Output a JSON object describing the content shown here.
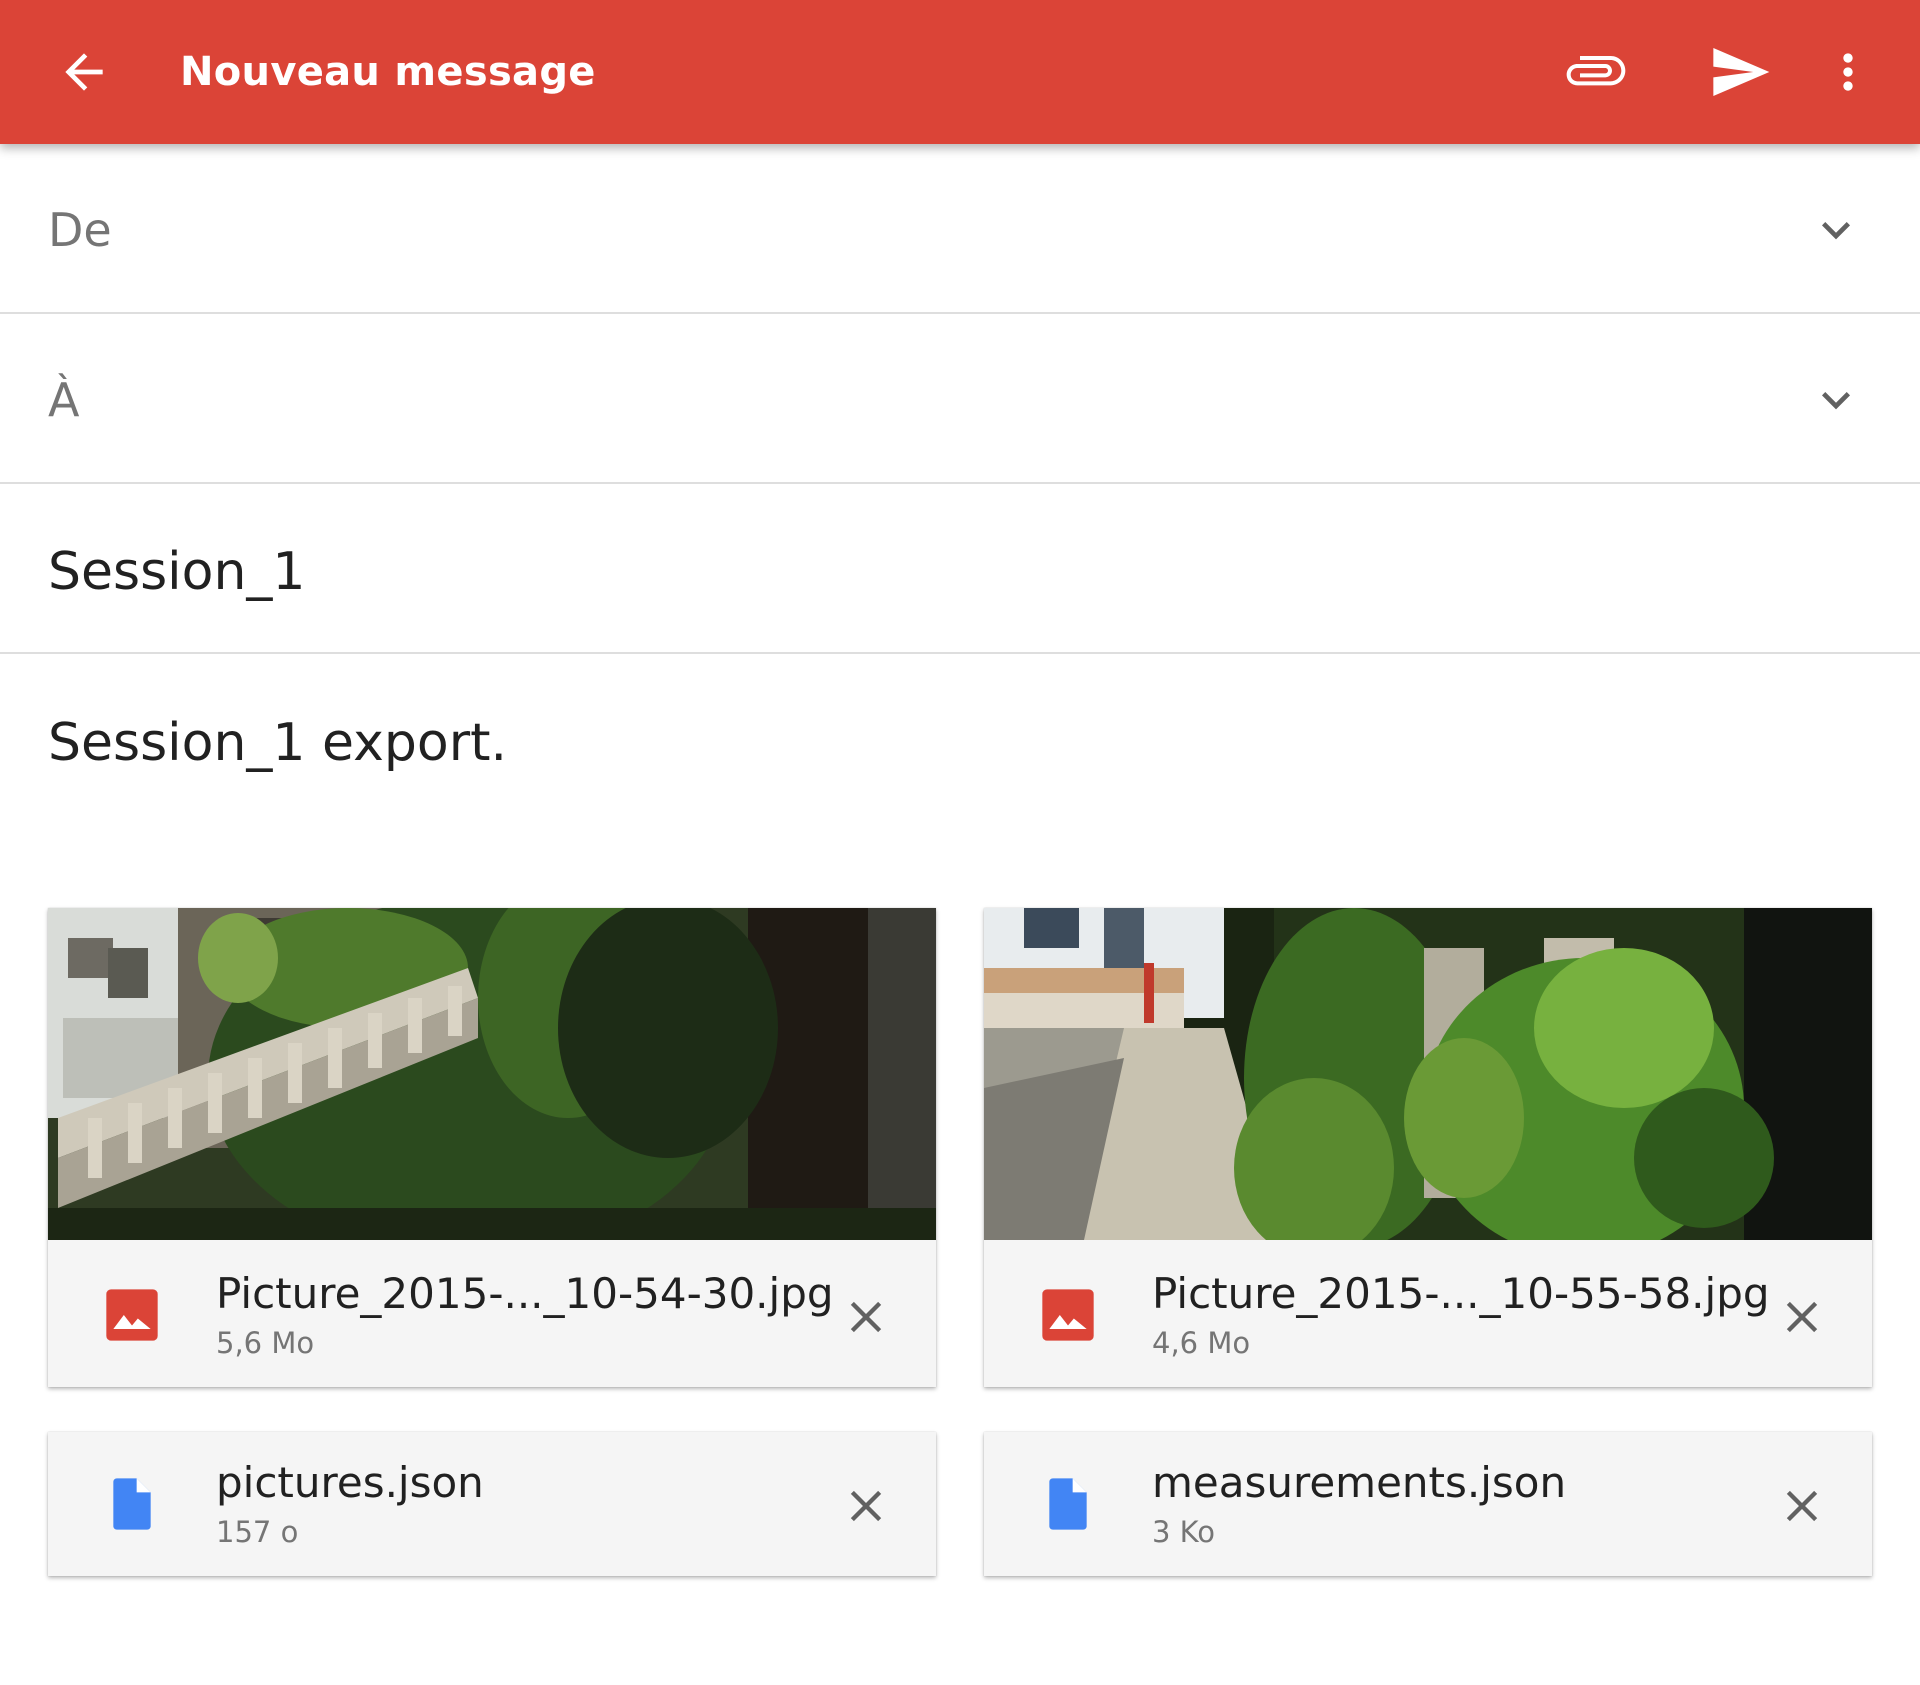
{
  "appbar": {
    "title": "Nouveau message",
    "color": "#db4437",
    "icons": [
      "back-arrow-icon",
      "paperclip-icon",
      "send-icon",
      "more-vert-icon"
    ]
  },
  "form": {
    "from_label": "De",
    "to_label": "À",
    "subject": "Session_1",
    "body": "Session_1 export."
  },
  "attachments": [
    {
      "name": "Picture_2015-..._10-54-30.jpg",
      "size": "5,6 Mo",
      "type": "image",
      "icon": "image-file-icon",
      "icon_color": "#db4437"
    },
    {
      "name": "Picture_2015-..._10-55-58.jpg",
      "size": "4,6 Mo",
      "type": "image",
      "icon": "image-file-icon",
      "icon_color": "#db4437"
    },
    {
      "name": "pictures.json",
      "size": "157 o",
      "type": "file",
      "icon": "document-file-icon",
      "icon_color": "#4285f4"
    },
    {
      "name": "measurements.json",
      "size": "3 Ko",
      "type": "file",
      "icon": "document-file-icon",
      "icon_color": "#4285f4"
    }
  ]
}
